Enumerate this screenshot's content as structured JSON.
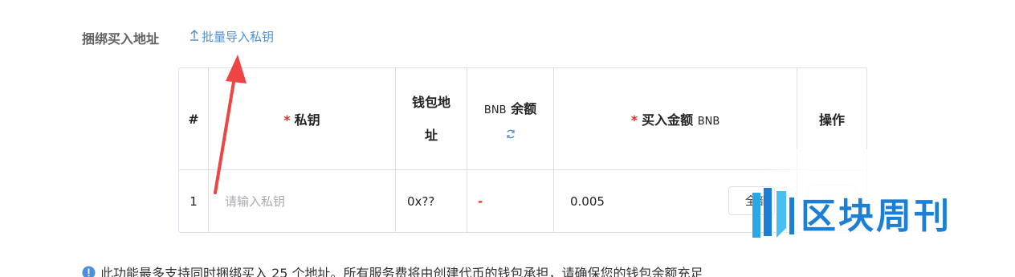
{
  "header": {
    "section_label": "捆绑买入地址",
    "import_link_label": "批量导入私钥",
    "import_icon": "upload-icon"
  },
  "table": {
    "columns": {
      "index": "#",
      "private_key": "私钥",
      "wallet_address_line1": "钱包地",
      "wallet_address_line2": "址",
      "bnb_balance_unit": "BNB",
      "bnb_balance_label": "余额",
      "buy_amount_label": "买入金额",
      "buy_amount_unit": "BNB",
      "actions": "操作"
    },
    "required_mark": "*",
    "refresh_icon": "refresh-icon",
    "rows": [
      {
        "index": "1",
        "private_key_value": "",
        "private_key_placeholder": "请输入私钥",
        "wallet_address": "0x??",
        "bnb_balance": "-",
        "buy_amount": "0.005",
        "all_button_label": "全部"
      }
    ]
  },
  "notice": {
    "icon": "info-icon",
    "text": "此功能最多支持同时捆绑买入 25 个地址。所有服务费将由创建代币的钱包承担，请确保您的钱包余额充足"
  },
  "watermark": {
    "text": "区块周刊"
  },
  "colors": {
    "link_blue": "#4a90d9",
    "required_red": "#d93025",
    "border": "#dcdfe6",
    "annotation_arrow": "#ee4444",
    "watermark_blue": "#1c7fd6"
  }
}
